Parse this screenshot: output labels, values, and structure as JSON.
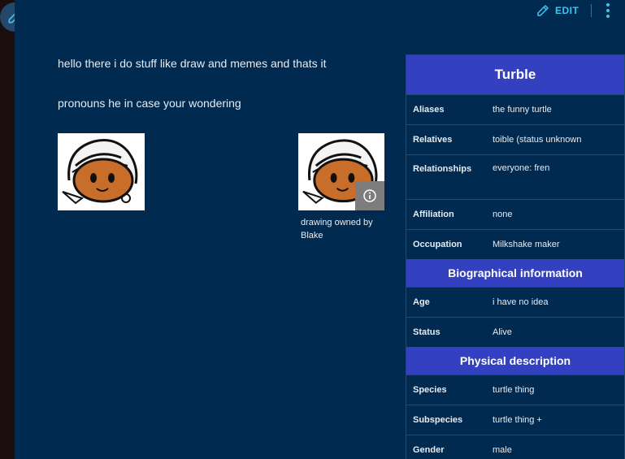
{
  "toolbar": {
    "edit_label": "EDIT"
  },
  "article": {
    "intro": "hello there i do stuff like draw and memes and thats it",
    "pronouns": "pronouns he in case your wondering",
    "image_caption": "drawing owned by Blake"
  },
  "icons": {
    "fab": "pencil-icon",
    "edit": "pencil-icon",
    "more": "more-vertical-icon",
    "info": "info-icon"
  },
  "colors": {
    "accent": "#3ec6f0",
    "infobox_header": "#3340bf",
    "background": "#002a50"
  },
  "infobox": {
    "title": "Turble",
    "rows1": [
      {
        "label": "Aliases",
        "value": "the funny turtle"
      },
      {
        "label": "Relatives",
        "value": "toible (status unknown"
      },
      {
        "label": "Relationships",
        "value": "everyone: fren"
      },
      {
        "label": "Affiliation",
        "value": "none"
      },
      {
        "label": "Occupation",
        "value": "Milkshake maker"
      }
    ],
    "section_bio": "Biographical information",
    "rows2": [
      {
        "label": "Age",
        "value": "i have no idea"
      },
      {
        "label": "Status",
        "value": "Alive"
      }
    ],
    "section_phys": "Physical description",
    "rows3": [
      {
        "label": "Species",
        "value": "turtle thing"
      },
      {
        "label": "Subspecies",
        "value": "turtle thing +"
      },
      {
        "label": "Gender",
        "value": "male"
      }
    ]
  }
}
